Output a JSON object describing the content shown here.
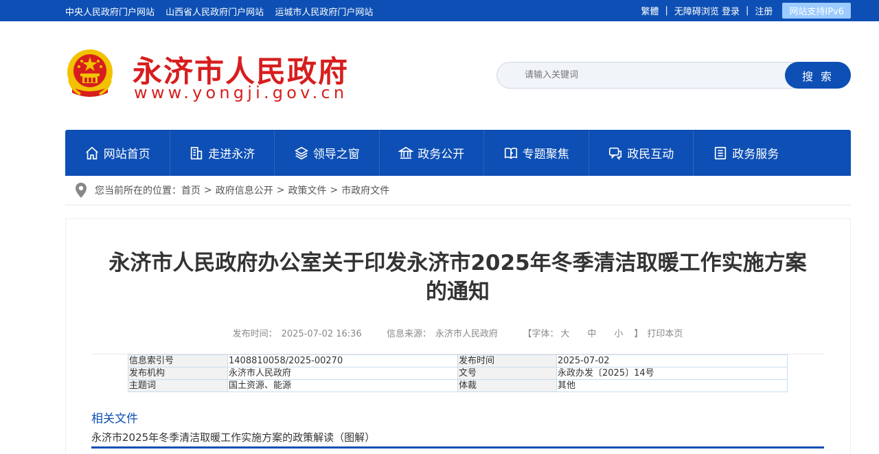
{
  "topbar": {
    "links": [
      "中央人民政府门户网站",
      "山西省人民政府门户网站",
      "运城市人民政府门户网站"
    ],
    "traditional": "繁體",
    "sep": "|",
    "accessible": "无障碍浏览",
    "login": "登录",
    "register": "注册",
    "ipv6": "网站支持IPv6"
  },
  "header": {
    "title": "永济市人民政府",
    "url": "www.yongji.gov.cn"
  },
  "search": {
    "placeholder": "请输入关键词",
    "button": "搜 索"
  },
  "nav": [
    {
      "label": "网站首页",
      "icon": "home-icon"
    },
    {
      "label": "走进永济",
      "icon": "building-icon"
    },
    {
      "label": "领导之窗",
      "icon": "layers-icon"
    },
    {
      "label": "政务公开",
      "icon": "bank-icon"
    },
    {
      "label": "专题聚焦",
      "icon": "book-icon"
    },
    {
      "label": "政民互动",
      "icon": "chat-icon"
    },
    {
      "label": "政务服务",
      "icon": "list-icon"
    }
  ],
  "breadcrumb": {
    "prefix": "您当前所在的位置：",
    "items": [
      "首页",
      "政府信息公开",
      "政策文件",
      "市政府文件"
    ],
    "sep": ">"
  },
  "article": {
    "title_line1": "永济市人民政府办公室关于印发永济市2025年冬季清洁取暖工作实施方案",
    "title_line2": "的通知",
    "meta": {
      "publish_label": "发布时间：",
      "publish_time": "2025-07-02 16:36",
      "source_label": "信息来源：",
      "source": "永济市人民政府",
      "font_label": "【字体：",
      "font_large": "大",
      "font_medium": "中",
      "font_small": "小",
      "font_close": "】",
      "print": "打印本页"
    },
    "info": [
      {
        "k1": "信息索引号",
        "v1": "1408810058/2025-00270",
        "k2": "发布时间",
        "v2": "2025-07-02"
      },
      {
        "k1": "发布机构",
        "v1": "永济市人民政府",
        "k2": "文号",
        "v2": "永政办发〔2025〕14号"
      },
      {
        "k1": "主题词",
        "v1": "国土资源、能源",
        "k2": "体裁",
        "v2": "其他"
      }
    ],
    "related_title": "相关文件",
    "related_items": [
      "永济市2025年冬季清洁取暖工作实施方案的政策解读（图解）"
    ]
  },
  "colors": {
    "primary": "#0d4fb4",
    "brand_red": "#d71e1e",
    "emblem_gold": "#f2c200"
  }
}
